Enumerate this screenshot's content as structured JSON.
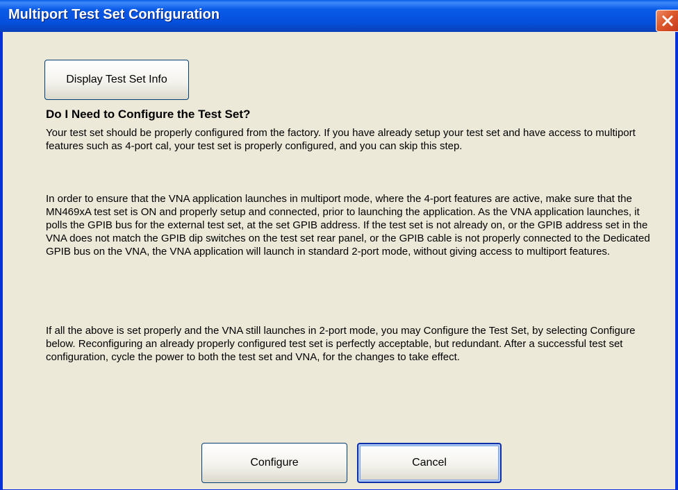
{
  "window": {
    "title": "Multiport Test Set Configuration",
    "close_icon": "close-icon",
    "colors": {
      "titlebar": "#0a5ae8",
      "body": "#ece9d8",
      "close": "#dd5a2c"
    }
  },
  "buttons": {
    "display_info": "Display Test Set Info",
    "configure": "Configure",
    "cancel": "Cancel"
  },
  "content": {
    "heading": "Do I Need to Configure the Test Set?",
    "paragraph1": "Your test set should be properly configured from the factory. If you have already setup your test set and have access to multiport features such as 4-port cal, your test set is properly configured, and you can skip this step.",
    "paragraph2": "In order to ensure that the VNA application launches in multiport mode, where the 4-port features are active, make sure that the MN469xA test set is ON and properly setup and connected, prior to launching the application. As the VNA application launches, it polls the GPIB bus for the external test set, at the set GPIB address. If the test set is not already on, or the GPIB address set in the VNA does not match the GPIB dip switches on the test set rear panel, or the GPIB cable is not properly connected to the Dedicated GPIB bus on the VNA, the VNA application will launch in standard 2-port mode, without giving access to multiport features.",
    "paragraph3": "If all the above is set properly and the VNA still launches in 2-port mode, you may Configure the Test Set, by selecting Configure below. Reconfiguring an already properly configured test set is perfectly acceptable, but redundant. After a successful test set configuration, cycle the power to both the test set and VNA, for the changes to take effect."
  }
}
